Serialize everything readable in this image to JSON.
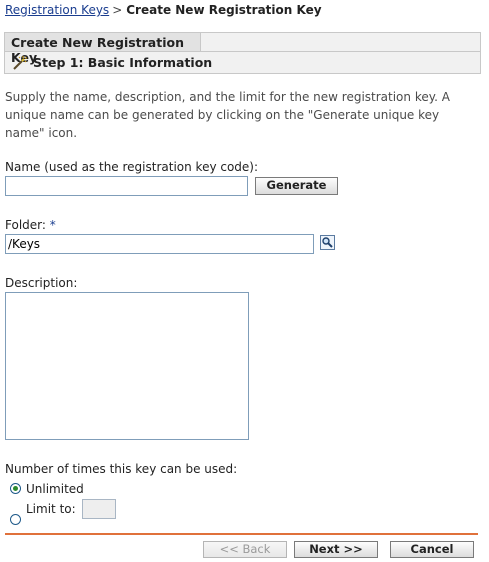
{
  "breadcrumb": {
    "parent": "Registration Keys",
    "separator": ">",
    "current": "Create New Registration Key"
  },
  "header": {
    "tab_label": "Create New Registration Key",
    "step_title": "Step 1: Basic Information",
    "step_icon": "wand-icon"
  },
  "intro_text": "Supply the name, description, and the limit for the new registration key. A unique name can be generated by clicking on the \"Generate unique key name\" icon.",
  "name_field": {
    "label": "Name (used as the registration key code):",
    "value": "",
    "generate_label": "Generate"
  },
  "folder_field": {
    "label": "Folder:",
    "required_mark": "*",
    "value": "/Keys",
    "browse_icon": "search-icon"
  },
  "description_field": {
    "label": "Description:",
    "value": ""
  },
  "usage": {
    "label": "Number of times this key can be used:",
    "options": [
      {
        "label": "Unlimited",
        "selected": true
      },
      {
        "label": "Limit to:",
        "selected": false
      }
    ],
    "limit_value": ""
  },
  "footer": {
    "back_label": "<< Back",
    "next_label": "Next >>",
    "cancel_label": "Cancel"
  },
  "colors": {
    "accent_divider": "#e0713b",
    "link": "#1a3d8f",
    "radio_selected": "#2d8a2d"
  }
}
